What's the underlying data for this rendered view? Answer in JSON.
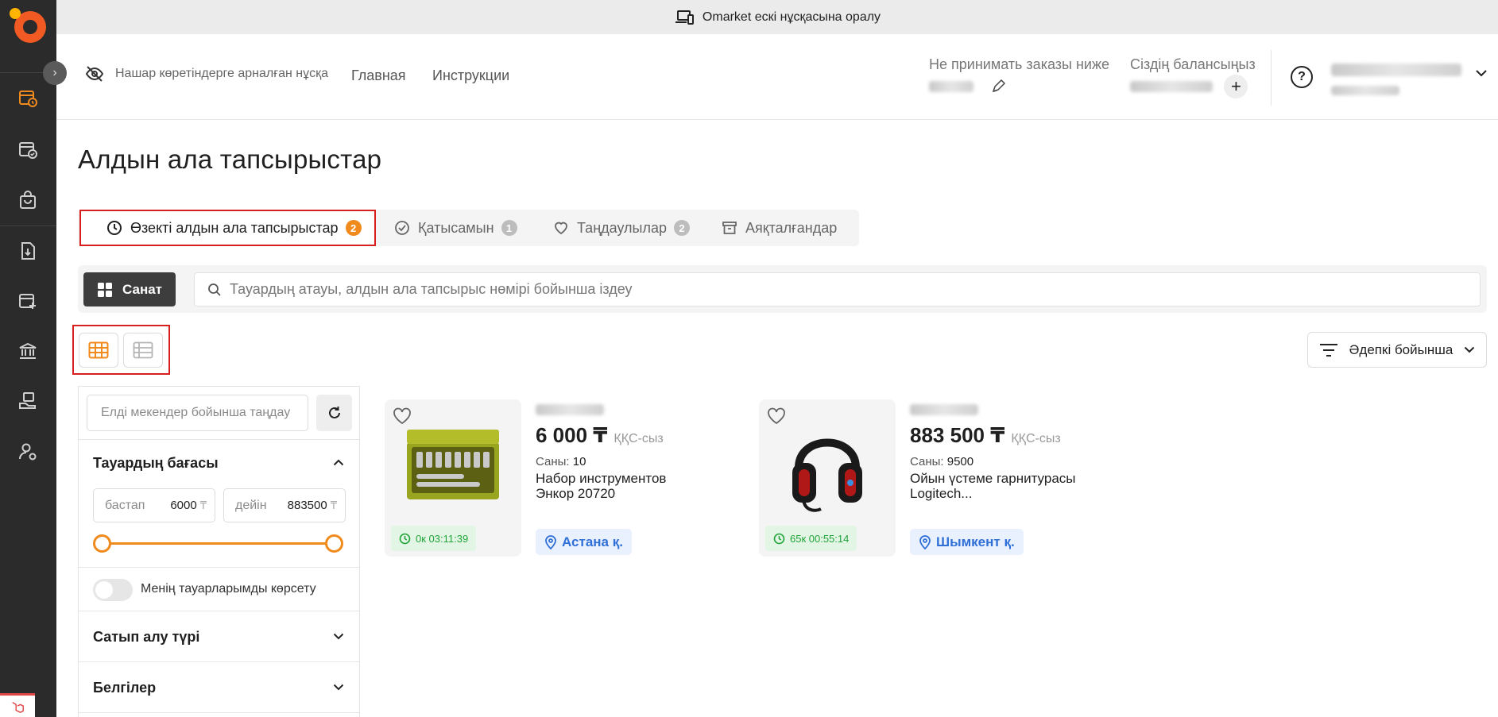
{
  "banner": {
    "text": "Omarket ескі нұсқасына оралу"
  },
  "header": {
    "accessibility_label": "Нашар көретіндерге арналған нұсқа",
    "nav": [
      "Главная",
      "Инструкции"
    ],
    "min_order_label": "Не принимать заказы ниже",
    "balance_label": "Сіздің балансыңыз",
    "plus_label": "+",
    "help_label": "?"
  },
  "page": {
    "title": "Алдын ала тапсырыстар"
  },
  "tabs": [
    {
      "label": "Өзекті алдын ала тапсырыстар",
      "count": "2",
      "icon": "clock-icon"
    },
    {
      "label": "Қатысамын",
      "count": "1",
      "icon": "check-circle-icon"
    },
    {
      "label": "Таңдаулылар",
      "count": "2",
      "icon": "heart-icon"
    },
    {
      "label": "Аяқталғандар",
      "count": "",
      "icon": "archive-icon"
    }
  ],
  "search": {
    "catalog_label": "Санат",
    "placeholder": "Тауардың атауы, алдын ала тапсырыс нөмірі бойынша іздеу"
  },
  "sort": {
    "label": "Әдепкі бойынша"
  },
  "filters": {
    "location_placeholder": "Елді мекендер бойынша таңдау",
    "price_title": "Тауардың бағасы",
    "from_label": "бастап",
    "from_value": "6000",
    "to_label": "дейін",
    "to_value": "883500",
    "currency": "₸",
    "my_products_label": "Менің тауарларымды көрсету",
    "purchase_type_label": "Сатып алу түрі",
    "tags_label": "Белгілер"
  },
  "products": [
    {
      "price": "6 000 ₸",
      "vat": "ҚҚС-сыз",
      "qty_label": "Саны:",
      "qty": "10",
      "name": "Набор инструментов Энкор 20720",
      "timer": "0к 03:11:39",
      "city": "Астана қ."
    },
    {
      "price": "883 500 ₸",
      "vat": "ҚҚС-сыз",
      "qty_label": "Саны:",
      "qty": "9500",
      "name": "Ойын үстеме гарнитурасы Logitech...",
      "timer": "65к 00:55:14",
      "city": "Шымкент қ."
    }
  ],
  "colors": {
    "accent": "#f08a1d",
    "highlight_border": "#d71f1f",
    "sidebar": "#2b2b2b",
    "timer_green": "#21a43a",
    "city_blue": "#2f6fd6"
  }
}
